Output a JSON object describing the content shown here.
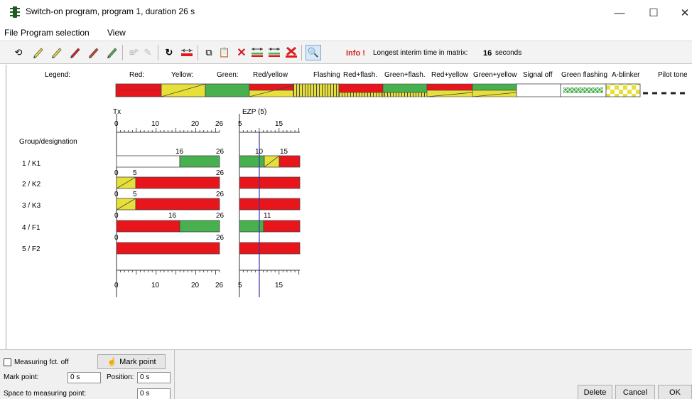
{
  "window": {
    "title": "Switch-on program, program 1, duration 26 s",
    "min_glyph": "—",
    "max_glyph": "☐",
    "close_glyph": "✕"
  },
  "menu": [
    "File",
    "Program selection",
    "View"
  ],
  "toolbar": {
    "info_label": "Info !",
    "info_text": "Longest interim time in matrix:",
    "info_value": "16",
    "info_unit": "seconds",
    "icons": [
      "undo-icon",
      "pencil-icon",
      "pencil-icon",
      "pencil-icon",
      "pencil-icon",
      "pencil-icon",
      "signal-group-icon",
      "eraser-icon",
      "rotate-icon",
      "move-bar-icon",
      "copy-icon",
      "paste-icon",
      "delete-icon",
      "stretch-icon",
      "shrink-icon",
      "clear-icon",
      "search-icon"
    ]
  },
  "legend": {
    "title": "Legend:",
    "items": [
      "Red:",
      "Yellow:",
      "Green:",
      "Red/yellow",
      "Flashing",
      "Red+flash.",
      "Green+flash.",
      "Red+yellow",
      "Green+yellow",
      "Signal off",
      "Green flashing",
      "A-blinker",
      "Pilot tone"
    ]
  },
  "colors": {
    "red": "#e8151d",
    "yellow": "#e8e03a",
    "green": "#49b04f",
    "marker": "#3a36a8"
  },
  "scales": {
    "main_label": "Tx",
    "ezp_label": "EZP (5)",
    "main_ticks": [
      "0",
      "10",
      "20",
      "26"
    ],
    "ezp_ticks": [
      "5",
      "15"
    ]
  },
  "group_header": "Group/designation",
  "groups": [
    {
      "name": "1 / K1",
      "labels": [
        "16",
        "26"
      ],
      "ezp_labels": [
        "10",
        "15"
      ]
    },
    {
      "name": "2 / K2",
      "labels": [
        "0",
        "5",
        "26"
      ],
      "ezp_labels": []
    },
    {
      "name": "3 / K3",
      "labels": [
        "0",
        "5",
        "26"
      ],
      "ezp_labels": []
    },
    {
      "name": "4 / F1",
      "labels": [
        "0",
        "16",
        "26"
      ],
      "ezp_labels": [
        "11"
      ]
    },
    {
      "name": "5 / F2",
      "labels": [
        "0",
        "26"
      ],
      "ezp_labels": []
    }
  ],
  "bottom": {
    "measuring_label": "Measuring fct. off",
    "mark_point_button": "Mark point",
    "mark_point_label": "Mark point:",
    "mark_point_value": "0 s",
    "position_label": "Position:",
    "position_value": "0 s",
    "space_label": "Space to measuring point:",
    "space_value": "0 s",
    "delete_button": "Delete",
    "cancel_button": "Cancel",
    "ok_button": "OK"
  }
}
